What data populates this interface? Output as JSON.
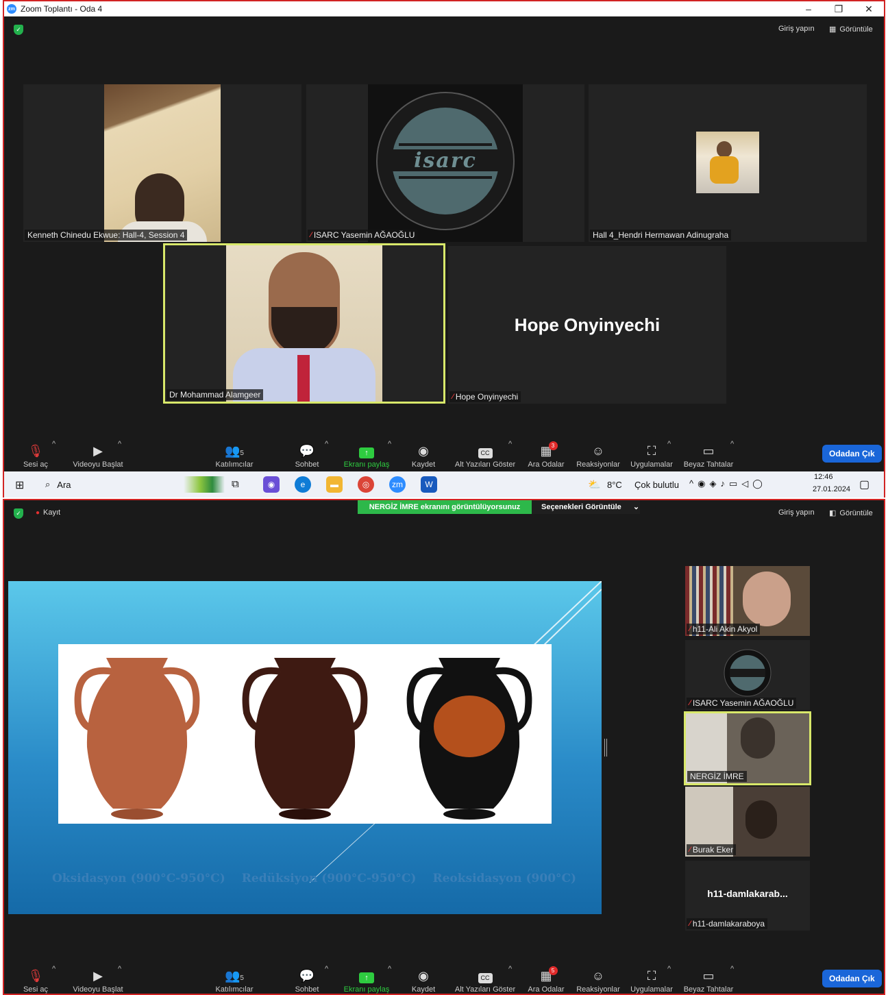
{
  "top": {
    "window_title": "Zoom Toplantı - Oda 4",
    "zoom_badge": "zm",
    "controls": {
      "minimize": "–",
      "restore": "❐",
      "close": "✕"
    },
    "sign_in": "Giriş yapın",
    "view": "Görüntüle",
    "tiles": [
      {
        "name": "Kenneth Chinedu Ekwue: Hall-4, Session 4"
      },
      {
        "name": "ISARC Yasemin AĞAOĞLU"
      },
      {
        "name": "Hall 4_Hendri Hermawan Adinugraha"
      },
      {
        "name": "Dr Mohammad Alamgeer"
      },
      {
        "name": "Hope Onyinyechi",
        "display": "Hope Onyinyechi"
      }
    ],
    "logo_text": "isarc",
    "end_button": "Odadan Çık"
  },
  "toolbar": {
    "unmute": "Sesi aç",
    "start_video": "Videoyu Başlat",
    "participants": "Katılımcılar",
    "participants_count": "5",
    "chat": "Sohbet",
    "share": "Ekranı paylaş",
    "record": "Kaydet",
    "captions": "Alt Yazıları Göster",
    "breakout": "Ara Odalar",
    "breakout_badge_1": "3",
    "breakout_badge_2": "5",
    "reactions": "Reaksiyonlar",
    "apps": "Uygulamalar",
    "whiteboard": "Beyaz Tahtalar",
    "cc_icon": "CC"
  },
  "taskbar": {
    "search": "Ara",
    "weather_temp": "8°C",
    "weather_text": "Çok bulutlu",
    "time": "12:46",
    "date": "27.01.2024"
  },
  "bottom": {
    "recording": "Kayıt",
    "viewing_banner": "NERGİZ İMRE ekranını görüntülüyorsunuz",
    "view_options": "Seçenekleri Görüntüle",
    "sign_in": "Giriş yapın",
    "view": "Görüntüle",
    "slide_captions": [
      "Oksidasyon (900°C-950°C)",
      "Redüksiyon (900°C-950°C)",
      "Reoksidasyon (900°C)"
    ],
    "side_tiles": [
      {
        "name": "h11-Ali Akin Akyol"
      },
      {
        "name": "ISARC Yasemin AĞAOĞLU"
      },
      {
        "name": "NERGİZ İMRE"
      },
      {
        "name": "Burak Eker"
      },
      {
        "name": "h11-damlakaraboya",
        "display": "h11-damlakarab..."
      }
    ],
    "end_button": "Odadan Çık"
  },
  "colors": {
    "accent_green": "#2ecc40",
    "frame_red": "#d12323",
    "active_speaker": "#d8e86a",
    "end_blue": "#1a66d9"
  }
}
